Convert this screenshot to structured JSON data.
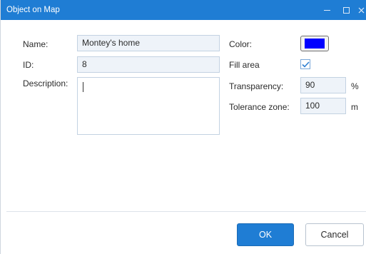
{
  "window": {
    "title": "Object on Map",
    "controls": {
      "minimize_icon": "minimize-icon",
      "maximize_icon": "maximize-icon",
      "close_icon": "close-icon"
    }
  },
  "form": {
    "name_label": "Name:",
    "name_value": "Montey's home",
    "id_label": "ID:",
    "id_value": "8",
    "description_label": "Description:",
    "description_value": "",
    "color_label": "Color:",
    "color_value": "#0000ff",
    "fill_label": "Fill area",
    "fill_checked": true,
    "transparency_label": "Transparency:",
    "transparency_value": "90",
    "transparency_unit": "%",
    "tolerance_label": "Tolerance zone:",
    "tolerance_value": "100",
    "tolerance_unit": "m"
  },
  "footer": {
    "ok_label": "OK",
    "cancel_label": "Cancel"
  },
  "colors": {
    "accent": "#1f7dd4",
    "field_bg": "#eef3f9",
    "checkbox_check": "#2f7fd1"
  }
}
